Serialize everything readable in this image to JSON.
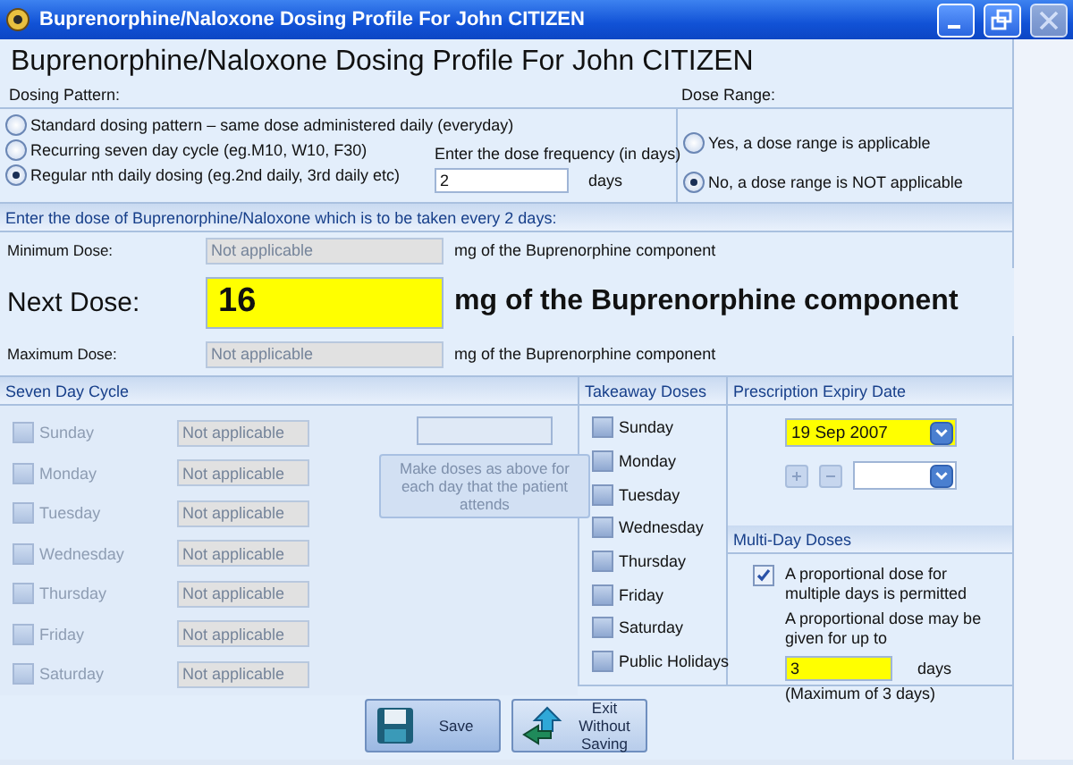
{
  "window": {
    "title": "Buprenorphine/Naloxone Dosing Profile For John CITIZEN"
  },
  "heading": "Buprenorphine/Naloxone Dosing Profile For John CITIZEN",
  "dosing_pattern": {
    "label": "Dosing Pattern:",
    "options": [
      {
        "label": "Standard dosing pattern – same dose administered daily (everyday)",
        "selected": false
      },
      {
        "label": "Recurring seven day cycle (eg.M10, W10, F30)",
        "selected": false
      },
      {
        "label": "Regular nth daily dosing (eg.2nd daily, 3rd daily etc)",
        "selected": true
      }
    ],
    "frequency_label": "Enter the dose frequency (in days)",
    "frequency_value": "2",
    "frequency_unit": "days"
  },
  "dose_range": {
    "label": "Dose Range:",
    "options": [
      {
        "label": "Yes, a dose range is applicable",
        "selected": false
      },
      {
        "label": "No, a dose range is NOT applicable",
        "selected": true
      }
    ]
  },
  "dose_section": {
    "title": "Enter the dose of Buprenorphine/Naloxone which is to be taken every 2 days:",
    "rows": [
      {
        "kind": "minor",
        "label": "Minimum Dose:",
        "value": "Not applicable",
        "disabled": true,
        "unit": "mg of the Buprenorphine component"
      },
      {
        "kind": "main",
        "label": "Next Dose:",
        "value": "16",
        "disabled": false,
        "unit": "mg of the Buprenorphine component"
      },
      {
        "kind": "minor",
        "label": "Maximum Dose:",
        "value": "Not applicable",
        "disabled": true,
        "unit": "mg of the Buprenorphine component"
      }
    ]
  },
  "seven_day_cycle": {
    "title": "Seven Day Cycle",
    "disabled": true,
    "days": [
      {
        "label": "Sunday",
        "checked": false,
        "value": "Not applicable"
      },
      {
        "label": "Monday",
        "checked": false,
        "value": "Not applicable"
      },
      {
        "label": "Tuesday",
        "checked": false,
        "value": "Not applicable"
      },
      {
        "label": "Wednesday",
        "checked": false,
        "value": "Not applicable"
      },
      {
        "label": "Thursday",
        "checked": false,
        "value": "Not applicable"
      },
      {
        "label": "Friday",
        "checked": false,
        "value": "Not applicable"
      },
      {
        "label": "Saturday",
        "checked": false,
        "value": "Not applicable"
      }
    ],
    "button": "Make doses as above for each day that the patient attends"
  },
  "takeaway_doses": {
    "title": "Takeaway Doses",
    "days": [
      {
        "label": "Sunday",
        "checked": false
      },
      {
        "label": "Monday",
        "checked": false
      },
      {
        "label": "Tuesday",
        "checked": false
      },
      {
        "label": "Wednesday",
        "checked": false
      },
      {
        "label": "Thursday",
        "checked": false
      },
      {
        "label": "Friday",
        "checked": false
      },
      {
        "label": "Saturday",
        "checked": false
      },
      {
        "label": "Public Holidays",
        "checked": false
      }
    ]
  },
  "prescription_expiry": {
    "title": "Prescription Expiry Date",
    "date": "19 Sep 2007"
  },
  "multi_day": {
    "title": "Multi-Day Doses",
    "permitted_label": "A proportional dose for multiple days is permitted",
    "permitted": true,
    "up_to_label": "A proportional dose may be given for up to",
    "days_value": "3",
    "days_unit": "days",
    "maximum_note": "(Maximum of 3 days)"
  },
  "buttons": [
    {
      "kind": "save",
      "label": "Save"
    },
    {
      "kind": "exit",
      "label": "Exit Without Saving"
    }
  ]
}
